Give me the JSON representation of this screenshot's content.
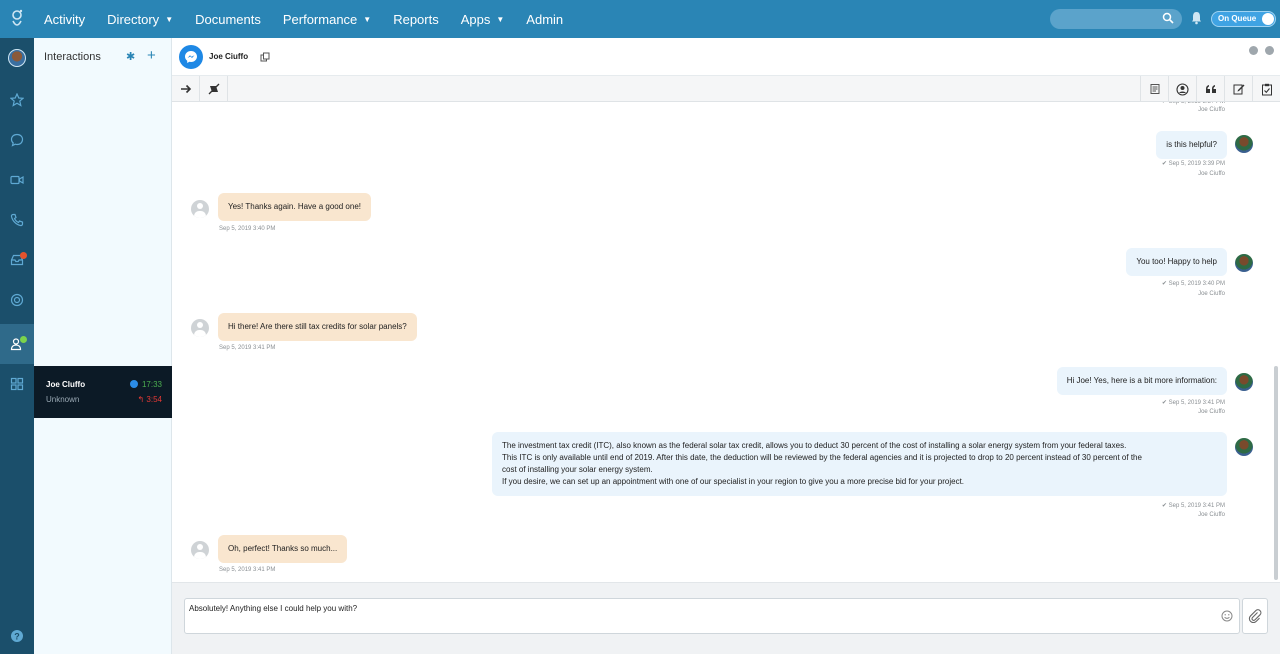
{
  "nav": {
    "items": [
      {
        "label": "Activity",
        "dropdown": false
      },
      {
        "label": "Directory",
        "dropdown": true
      },
      {
        "label": "Documents",
        "dropdown": false
      },
      {
        "label": "Performance",
        "dropdown": true
      },
      {
        "label": "Reports",
        "dropdown": false
      },
      {
        "label": "Apps",
        "dropdown": true
      },
      {
        "label": "Admin",
        "dropdown": false
      }
    ],
    "search_placeholder": "",
    "queue_status": "On Queue"
  },
  "colors": {
    "topbar": "#2a85b5",
    "rail": "#1b4f6b",
    "customer_bubble": "#f9e6cf",
    "agent_bubble": "#eaf4fc",
    "timer_green": "#4caf50",
    "timer_red": "#e53935"
  },
  "rail_icons": [
    "user-avatar",
    "star-icon",
    "chat-icon",
    "video-icon",
    "phone-icon",
    "inbox-icon",
    "lifebuoy-icon",
    "agent-status-icon",
    "dashboard-icon",
    "help-icon"
  ],
  "interactions": {
    "title": "Interactions",
    "card": {
      "name": "Joe Cluffo",
      "status": "Unknown",
      "timer_total": "17:33",
      "timer_wait": "3:54"
    }
  },
  "conversation": {
    "contact_name": "Joe Ciuffo",
    "channel_icon": "messenger-icon"
  },
  "messages": [
    {
      "direction": "out",
      "text": "is this helpful?",
      "time": "Sep 5, 2019 3:39 PM",
      "author": "Joe Ciuffo"
    },
    {
      "direction": "in",
      "text": "Yes! Thanks again. Have a good one!",
      "time": "Sep 5, 2019 3:40 PM"
    },
    {
      "direction": "out",
      "text": "You too! Happy to help",
      "time": "Sep 5, 2019 3:40 PM",
      "author": "Joe Ciuffo"
    },
    {
      "direction": "in",
      "text": "Hi there! Are there still tax credits for solar panels?",
      "time": "Sep 5, 2019 3:41 PM"
    },
    {
      "direction": "out",
      "text": "Hi Joe! Yes, here is a bit more information:",
      "time": "Sep 5, 2019 3:41 PM",
      "author": "Joe Ciuffo"
    },
    {
      "direction": "out",
      "lines": [
        "The investment tax credit (ITC), also known as the federal solar tax credit, allows you to deduct 30 percent of the cost of installing a solar energy system from your federal taxes.",
        "This ITC is only available until end of 2019. After this date, the deduction will be reviewed by the federal agencies and it is projected to drop to 20 percent instead of 30 percent of the",
        "cost of installing your solar energy system.",
        "If you desire, we can set up an appointment with one of our specialist in your region to give you a more precise bid for your project."
      ],
      "time": "Sep 5, 2019 3:41 PM",
      "author": "Joe Ciuffo"
    },
    {
      "direction": "in",
      "text": "Oh, perfect! Thanks so much...",
      "time": "Sep 5, 2019 3:41 PM"
    }
  ],
  "partial_top": {
    "author": "Joe Ciuffo"
  },
  "compose": {
    "value": "Absolutely! Anything else I could help you with?"
  }
}
